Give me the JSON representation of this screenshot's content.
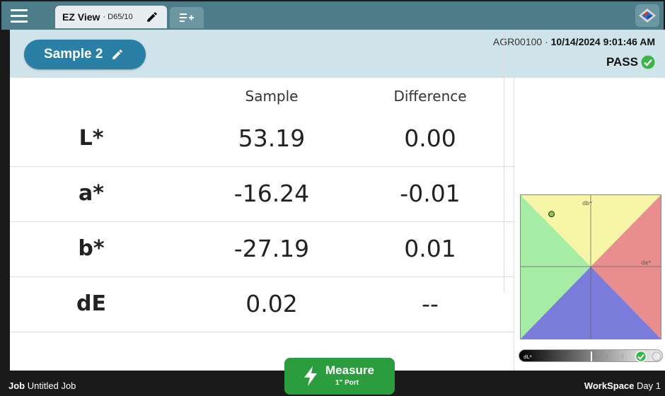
{
  "topbar": {
    "tab_title": "EZ View",
    "tab_subtitle": "· D65/10",
    "icons": {
      "menu": "hamburger-menu-icon",
      "edit": "pencil-icon",
      "new_tab": "add-list-icon",
      "logo": "app-logo-icon"
    }
  },
  "header": {
    "sample_label": "Sample 2",
    "instrument_id": "AGR00100 ·",
    "timestamp": "10/14/2024 9:01:46 AM",
    "status": "PASS",
    "status_color": "#3ab54a"
  },
  "table": {
    "col_sample": "Sample",
    "col_difference": "Difference",
    "rows": [
      {
        "label": "L*",
        "sample": "53.19",
        "difference": "0.00"
      },
      {
        "label": "a*",
        "sample": "-16.24",
        "difference": "-0.01"
      },
      {
        "label": "b*",
        "sample": "-27.19",
        "difference": "0.01"
      },
      {
        "label": "dE",
        "sample": "0.02",
        "difference": "--"
      }
    ]
  },
  "chart": {
    "db_label": "db*",
    "da_label": "da*",
    "dl_label": "dL*",
    "colors": {
      "yellow": "#f7f6a6",
      "red": "#e88e8e",
      "green": "#a6eba6",
      "blue": "#7b7bdc",
      "point": "#8dc63f"
    }
  },
  "footer": {
    "job_key": "Job",
    "job_value": "Untitled Job",
    "workspace_key": "WorkSpace",
    "workspace_value": "Day 1",
    "measure_label": "Measure",
    "measure_port": "1\" Port"
  }
}
